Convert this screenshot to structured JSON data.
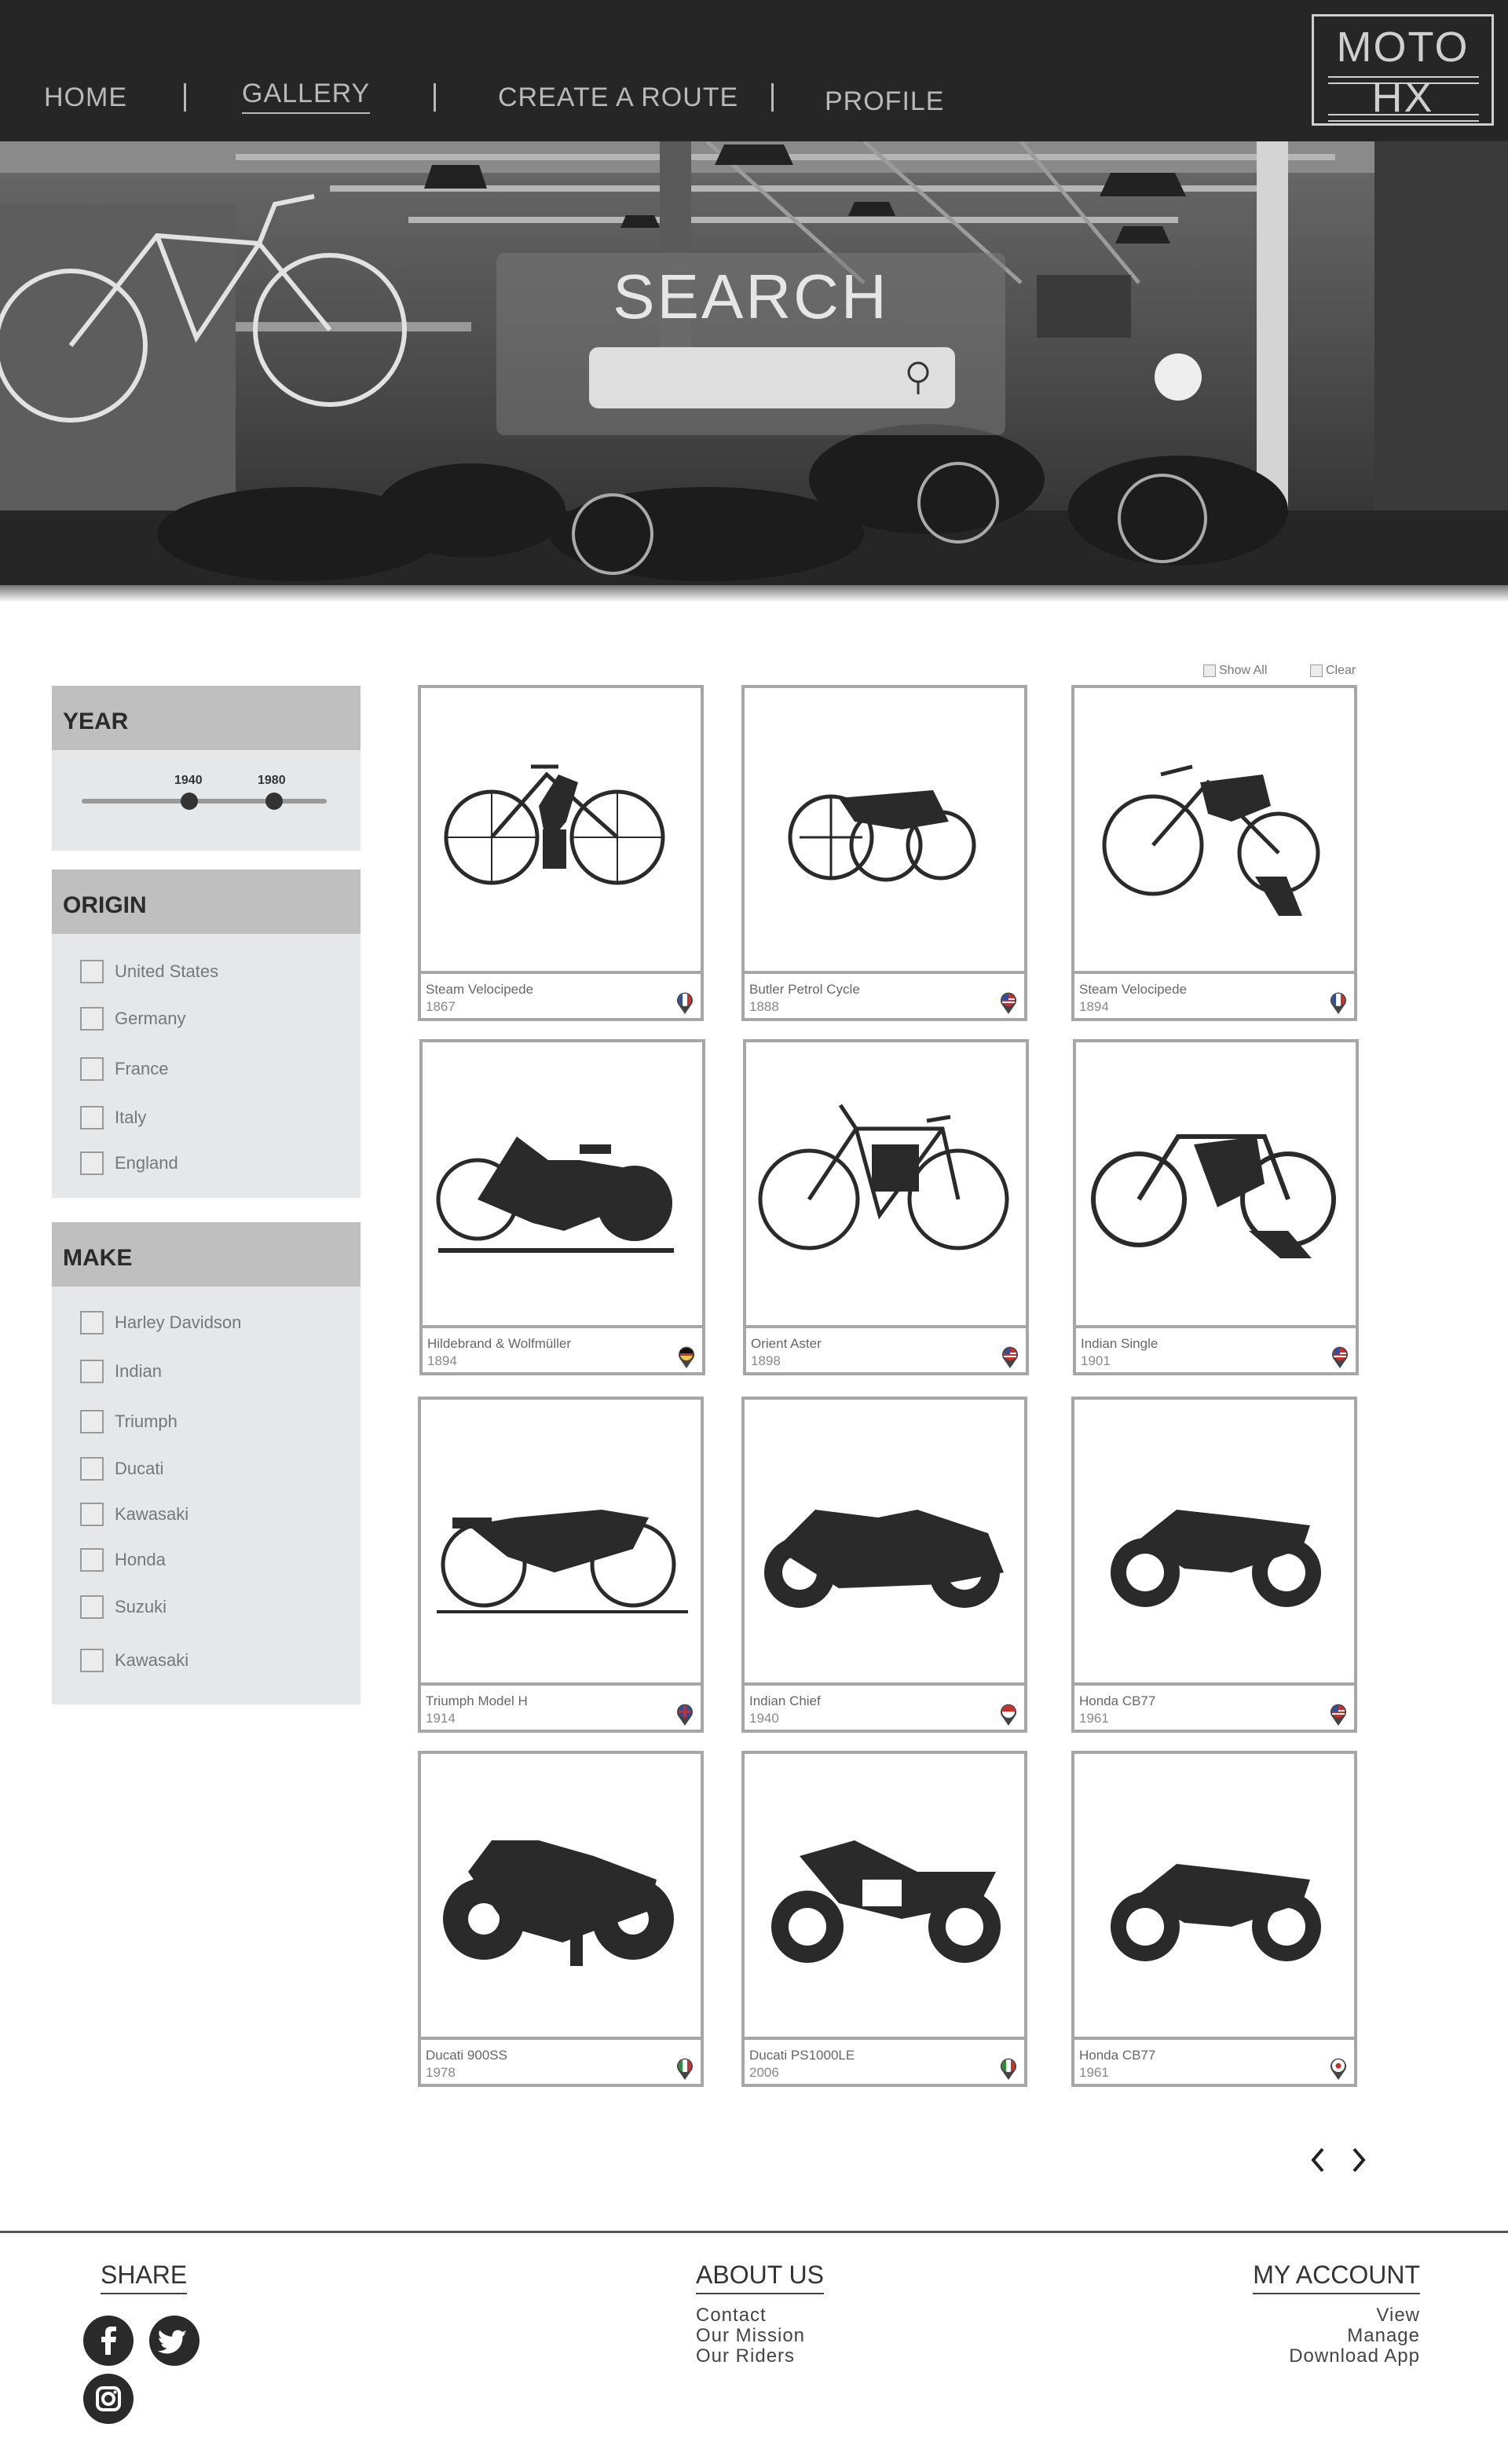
{
  "nav": {
    "home": "HOME",
    "gallery": "GALLERY",
    "create_route": "CREATE A ROUTE",
    "profile": "PROFILE"
  },
  "logo": {
    "line1": "MOTO",
    "line2": "HX"
  },
  "search": {
    "title": "SEARCH",
    "placeholder": ""
  },
  "filters": {
    "year": {
      "title": "YEAR",
      "min_label": "1940",
      "max_label": "1980"
    },
    "origin": {
      "title": "ORIGIN",
      "options": [
        "United States",
        "Germany",
        "France",
        "Italy",
        "England"
      ]
    },
    "make": {
      "title": "MAKE",
      "options": [
        "Harley Davidson",
        "Indian",
        "Triumph",
        "Ducati",
        "Kawasaki",
        "Honda",
        "Suzuki",
        "Kawasaki"
      ]
    }
  },
  "gallery_controls": {
    "show_all": "Show All",
    "clear": "Clear"
  },
  "cards": [
    {
      "name": "Steam Velocipede",
      "year": "1867",
      "flag": "france"
    },
    {
      "name": "Butler Petrol Cycle",
      "year": "1888",
      "flag": "usa"
    },
    {
      "name": "Steam Velocipede",
      "year": "1894",
      "flag": "france"
    },
    {
      "name": "Hildebrand & Wolfmüller",
      "year": "1894",
      "flag": "germany"
    },
    {
      "name": "Orient Aster",
      "year": "1898",
      "flag": "usa"
    },
    {
      "name": "Indian Single",
      "year": "1901",
      "flag": "usa"
    },
    {
      "name": "Triumph Model H",
      "year": "1914",
      "flag": "uk"
    },
    {
      "name": "Indian Chief",
      "year": "1940",
      "flag": "usa"
    },
    {
      "name": "Honda CB77",
      "year": "1961",
      "flag": "usa"
    },
    {
      "name": "Ducati 900SS",
      "year": "1978",
      "flag": "italy"
    },
    {
      "name": "Ducati PS1000LE",
      "year": "2006",
      "flag": "italy"
    },
    {
      "name": "Honda CB77",
      "year": "1961",
      "flag": "japan"
    }
  ],
  "footer": {
    "share": {
      "title": "SHARE"
    },
    "about": {
      "title": "ABOUT US",
      "links": [
        "Contact",
        "Our Mission",
        "Our Riders"
      ]
    },
    "account": {
      "title": "MY ACCOUNT",
      "links": [
        "View",
        "Manage",
        "Download App"
      ]
    }
  }
}
